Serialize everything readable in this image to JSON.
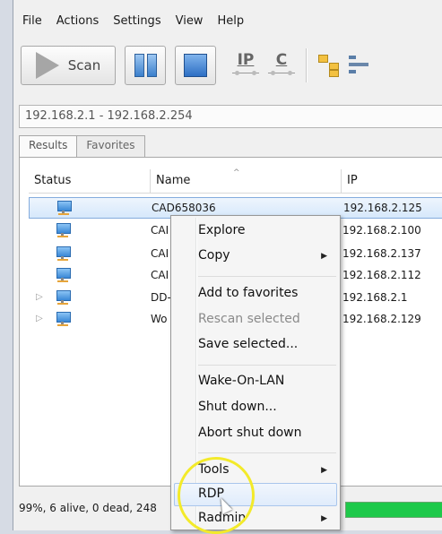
{
  "menu": [
    "File",
    "Actions",
    "Settings",
    "View",
    "Help"
  ],
  "toolbar": {
    "scan_label": "Scan",
    "ip_icon_letters": "IP",
    "c_icon_letters": "C"
  },
  "ip_range": "192.168.2.1 - 192.168.2.254",
  "tabs": [
    "Results",
    "Favorites"
  ],
  "table": {
    "columns": [
      "Status",
      "Name",
      "IP"
    ],
    "rows": [
      {
        "name": "CAD658036",
        "ip": "192.168.2.125",
        "selected": true,
        "expandable": false
      },
      {
        "name": "CAI",
        "ip": "192.168.2.100",
        "selected": false,
        "expandable": false
      },
      {
        "name": "CAI",
        "ip": "192.168.2.137",
        "selected": false,
        "expandable": false
      },
      {
        "name": "CAI",
        "ip": "192.168.2.112",
        "selected": false,
        "expandable": false
      },
      {
        "name": "DD-",
        "ip": "192.168.2.1",
        "selected": false,
        "expandable": true
      },
      {
        "name": "Wo",
        "ip": "192.168.2.129",
        "selected": false,
        "expandable": true
      }
    ]
  },
  "context_menu": {
    "explore": "Explore",
    "copy": "Copy",
    "add_to_favorites": "Add to favorites",
    "rescan_selected": "Rescan selected",
    "save_selected": "Save selected...",
    "wake_on_lan": "Wake-On-LAN",
    "shut_down": "Shut down...",
    "abort_shut_down": "Abort shut down",
    "tools": "Tools",
    "rdp": "RDP",
    "radmin": "Radmin"
  },
  "status": {
    "text": "99%, 6 alive, 0 dead, 248",
    "progress_percent": 99
  },
  "colors": {
    "accent": "#3a88d6",
    "progress": "#1ec94a",
    "highlight_circle": "#f3ea2a"
  }
}
